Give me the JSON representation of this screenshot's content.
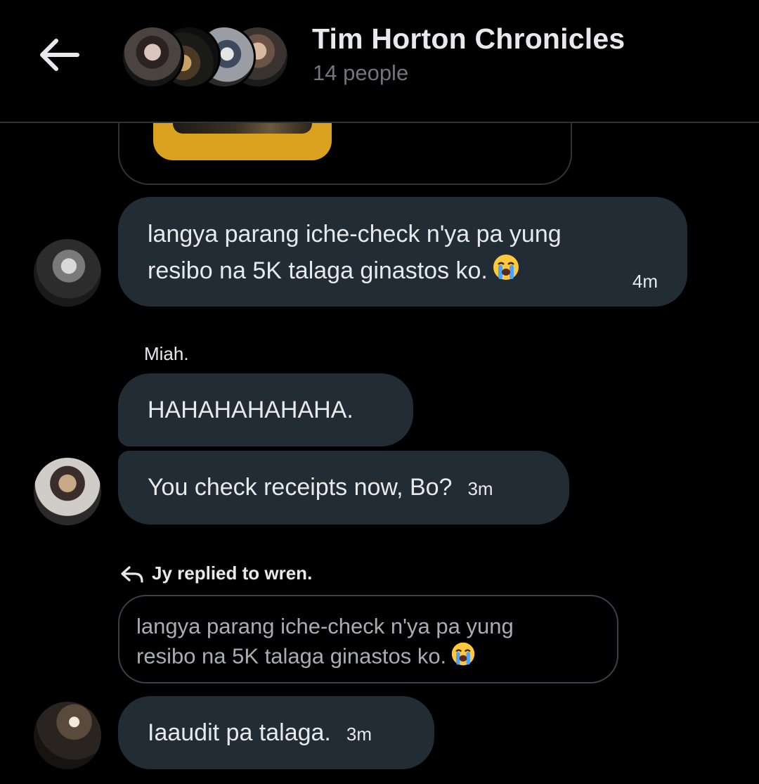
{
  "header": {
    "title": "Tim Horton Chronicles",
    "member_count": "14 people",
    "back_icon": "arrow-left-icon"
  },
  "messages": [
    {
      "id": "m1",
      "text_lines": [
        "langya parang iche-check n'ya pa yung",
        "resibo na 5K talaga ginastos ko."
      ],
      "emoji": "loudly-crying-face",
      "time": "4m"
    },
    {
      "id": "m2",
      "sender": "Miah.",
      "text": "HAHAHAHAHAHA."
    },
    {
      "id": "m3",
      "text": "You check receipts now, Bo?",
      "time": "3m"
    },
    {
      "id": "m4",
      "reply_info": "Jy replied to wren.",
      "quoted_lines": [
        "langya parang iche-check n'ya pa yung",
        "resibo na 5K talaga ginastos ko."
      ],
      "quoted_emoji": "loudly-crying-face",
      "text": "Iaaudit pa talaga.",
      "time": "3m"
    }
  ],
  "colors": {
    "background": "#000000",
    "bubble": "#212c35",
    "muted_text": "#71767b",
    "border": "#2f3336",
    "media_frame": "#dba21f"
  }
}
